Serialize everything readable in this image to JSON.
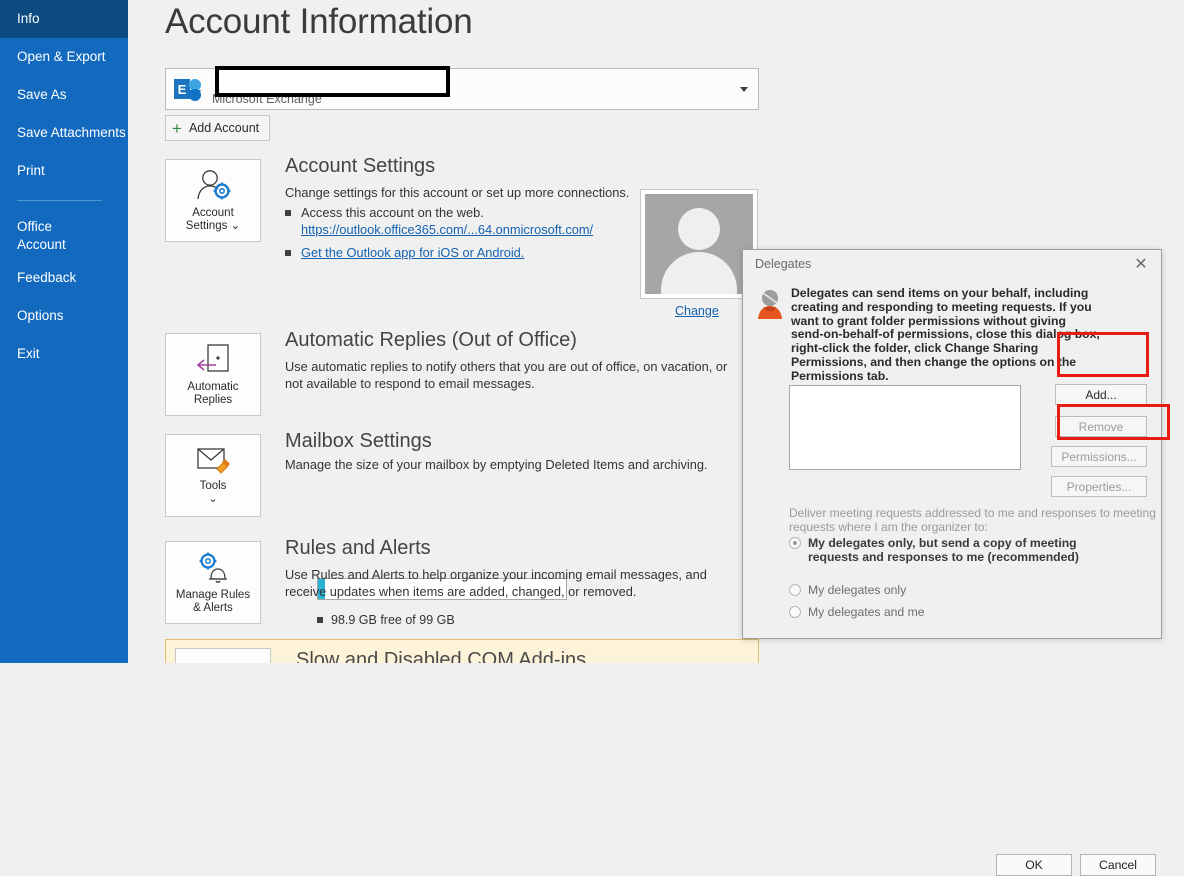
{
  "sidebar": {
    "items": [
      {
        "label": "Info",
        "active": true
      },
      {
        "label": "Open & Export",
        "active": false
      },
      {
        "label": "Save As",
        "active": false
      },
      {
        "label": "Save Attachments",
        "active": false
      },
      {
        "label": "Print",
        "active": false
      },
      {
        "label": "Office Account",
        "active": false,
        "two_line": true
      },
      {
        "label": "Feedback",
        "active": false
      },
      {
        "label": "Options",
        "active": false
      },
      {
        "label": "Exit",
        "active": false
      }
    ]
  },
  "page": {
    "title": "Account Information"
  },
  "account": {
    "name": "",
    "type": "Microsoft Exchange",
    "icon": "exchange-icon",
    "add_account_label": "Add Account"
  },
  "sections": {
    "account_settings": {
      "button_label": "Account\nSettings",
      "button_label_line1": "Account",
      "button_label_line2": "Settings",
      "heading": "Account Settings",
      "description": "Change settings for this account or set up more connections.",
      "bullet1_text": "Access this account on the web.",
      "bullet1_link": "https://outlook.office365.com/...64.onmicrosoft.com/",
      "bullet2_link": "Get the Outlook app for iOS or Android.",
      "photo_change_label": "Change"
    },
    "automatic_replies": {
      "button_label_line1": "Automatic",
      "button_label_line2": "Replies",
      "heading": "Automatic Replies (Out of Office)",
      "description": "Use automatic replies to notify others that you are out of office, on vacation, or not available to respond to email messages."
    },
    "mailbox_settings": {
      "button_label_line1": "Tools",
      "heading": "Mailbox Settings",
      "description": "Manage the size of your mailbox by emptying Deleted Items and archiving.",
      "storage_text": "98.9 GB free of 99 GB",
      "gauge_percent": 3
    },
    "rules_and_alerts": {
      "button_label_line1": "Manage Rules",
      "button_label_line2": "& Alerts",
      "heading": "Rules and Alerts",
      "description": "Use Rules and Alerts to help organize your incoming email messages, and receive updates when items are added, changed, or removed."
    },
    "com_addins": {
      "heading": "Slow and Disabled COM Add-ins"
    }
  },
  "dialog": {
    "title": "Delegates",
    "close_label": "✕",
    "intro": "Delegates can send items on your behalf, including creating and responding to meeting requests. If you want to grant folder permissions without giving send-on-behalf-of permissions, close this dialog box, right-click the folder, click Change Sharing Permissions, and then change the options on the Permissions tab.",
    "list_items": [],
    "buttons": {
      "add": "Add...",
      "remove": "Remove",
      "permissions": "Permissions...",
      "properties": "Properties..."
    },
    "deliver_label": "Deliver meeting requests addressed to me and responses to meeting requests where I am the organizer to:",
    "radios": [
      {
        "label": "My delegates only, but send a copy of meeting requests and responses to me (recommended)",
        "selected": true
      },
      {
        "label": "My delegates only",
        "selected": false
      },
      {
        "label": "My delegates and me",
        "selected": false
      }
    ],
    "footer": {
      "ok": "OK",
      "cancel": "Cancel"
    }
  },
  "annotations": {
    "highlight_color": "#e81b14",
    "boxes": [
      "add-button-highlight",
      "permissions-button-highlight"
    ]
  }
}
